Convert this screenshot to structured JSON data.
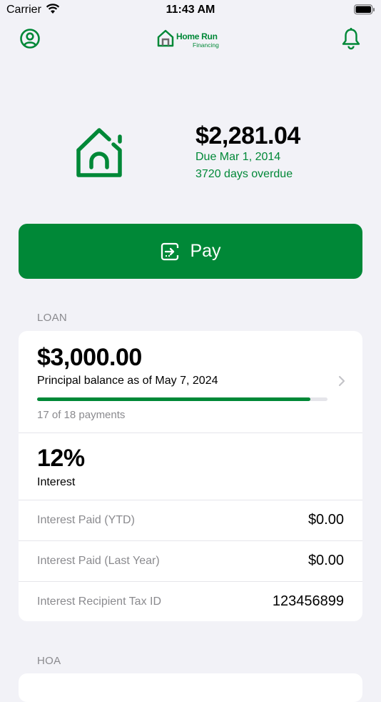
{
  "status_bar": {
    "carrier": "Carrier",
    "time": "11:43 AM"
  },
  "header": {
    "logo_name": "Home Run",
    "logo_sub": "Financing",
    "icons": [
      "profile-icon",
      "bell-icon"
    ]
  },
  "due": {
    "amount": "$2,281.04",
    "date": "Due Mar 1, 2014",
    "overdue": "3720 days overdue"
  },
  "pay_button": {
    "label": "Pay",
    "icon": "pay-icon"
  },
  "loan": {
    "section_label": "LOAN",
    "principal_amount": "$3,000.00",
    "principal_label": "Principal balance as of May 7, 2024",
    "payments_text": "17 of 18 payments",
    "progress_fraction": 0.94,
    "interest_rate": "12%",
    "interest_label": "Interest",
    "rows": [
      {
        "label": "Interest Paid (YTD)",
        "value": "$0.00"
      },
      {
        "label": "Interest Paid (Last Year)",
        "value": "$0.00"
      },
      {
        "label": "Interest Recipient Tax ID",
        "value": "123456899"
      }
    ]
  },
  "hoa": {
    "section_label": "HOA"
  },
  "colors": {
    "brand_green": "#008837",
    "background": "#f2f2f7",
    "secondary_text": "#8a8a8e"
  }
}
